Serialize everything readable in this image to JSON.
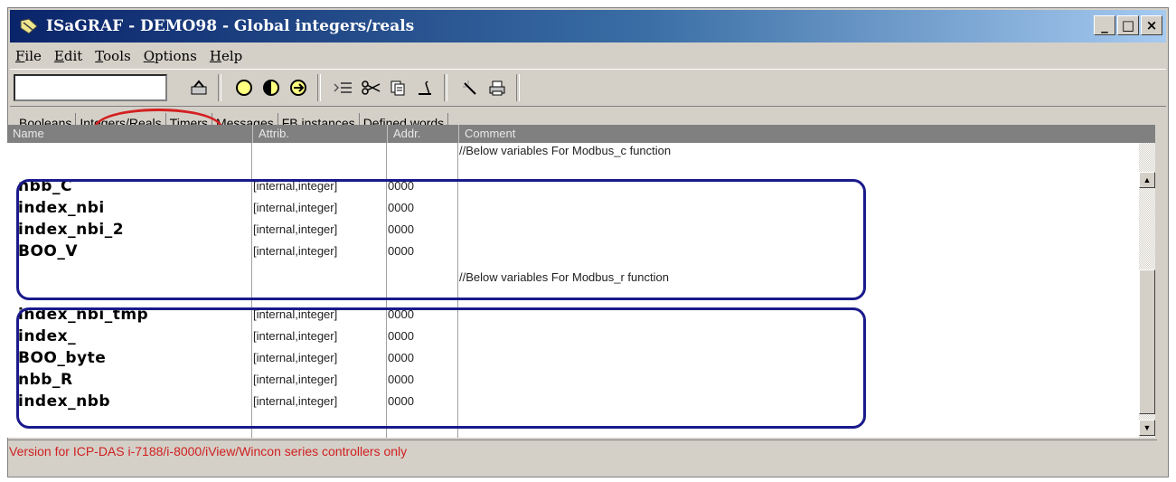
{
  "window": {
    "title": "ISaGRAF - DEMO98 - Global integers/reals",
    "controls": {
      "minimize": "_",
      "maximize": "□",
      "close": "×"
    }
  },
  "menu": [
    {
      "accel": "F",
      "rest": "ile"
    },
    {
      "accel": "E",
      "rest": "dit"
    },
    {
      "accel": "T",
      "rest": "ools"
    },
    {
      "accel": "O",
      "rest": "ptions"
    },
    {
      "accel": "H",
      "rest": "elp"
    }
  ],
  "toolbar": {
    "combo_value": "",
    "icons": [
      "apply-icon",
      "circle-empty-icon",
      "circle-half-icon",
      "circle-arrow-icon",
      "insert-row-icon",
      "cut-icon",
      "copy-icon",
      "paste-icon",
      "wand-icon",
      "print-icon"
    ]
  },
  "tabs": [
    {
      "label": "Booleans"
    },
    {
      "label": "Integers/Reals",
      "active": true
    },
    {
      "label": "Timers"
    },
    {
      "label": "Messages"
    },
    {
      "label": "FB instances"
    },
    {
      "label": "Defined words"
    }
  ],
  "grid": {
    "columns": [
      "Name",
      "Attrib.",
      "Addr.",
      "Comment"
    ],
    "rows": [
      {
        "name": "",
        "attrib": "",
        "addr": "",
        "comment": "//Below variables For Modbus_c function"
      },
      {
        "name": "nbb_C",
        "attrib": "[internal,integer]",
        "addr": "0000",
        "comment": ""
      },
      {
        "name": "index_nbi",
        "attrib": "[internal,integer]",
        "addr": "0000",
        "comment": ""
      },
      {
        "name": "index_nbi_2",
        "attrib": "[internal,integer]",
        "addr": "0000",
        "comment": ""
      },
      {
        "name": "BOO_V",
        "attrib": "[internal,integer]",
        "addr": "0000",
        "comment": ""
      },
      {
        "name": "",
        "attrib": "",
        "addr": "",
        "comment": "//Below variables For Modbus_r function"
      },
      {
        "name": "index_nbi_tmp",
        "attrib": "[internal,integer]",
        "addr": "0000",
        "comment": ""
      },
      {
        "name": "index_",
        "attrib": "[internal,integer]",
        "addr": "0000",
        "comment": ""
      },
      {
        "name": "BOO_byte",
        "attrib": "[internal,integer]",
        "addr": "0000",
        "comment": ""
      },
      {
        "name": "nbb_R",
        "attrib": "[internal,integer]",
        "addr": "0000",
        "comment": ""
      },
      {
        "name": "index_nbb",
        "attrib": "[internal,integer]",
        "addr": "0000",
        "comment": ""
      }
    ]
  },
  "status": "Version for ICP-DAS i-7188/i-8000/iView/Wincon series controllers only",
  "colors": {
    "title_bar": "#0a246a",
    "highlight_red": "#d42020",
    "group_box_blue": "#1a1a8c",
    "status_text": "#d02020"
  }
}
